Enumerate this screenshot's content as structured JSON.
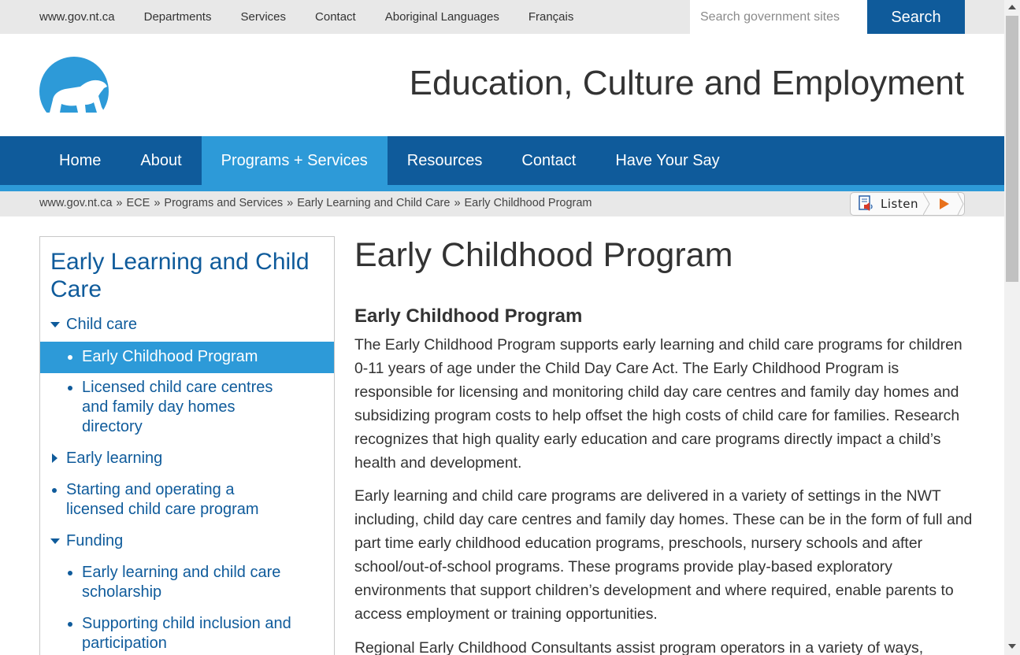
{
  "topbar": {
    "links": [
      "www.gov.nt.ca",
      "Departments",
      "Services",
      "Contact",
      "Aboriginal Languages",
      "Français"
    ],
    "search_placeholder": "Search government sites",
    "search_button": "Search"
  },
  "header": {
    "title": "Education, Culture and Employment",
    "logo_icon": "polar-bear-logo"
  },
  "nav": {
    "items": [
      "Home",
      "About",
      "Programs + Services",
      "Resources",
      "Contact",
      "Have Your Say"
    ],
    "active": "Programs + Services"
  },
  "breadcrumb": {
    "items": [
      "www.gov.nt.ca",
      "ECE",
      "Programs and Services",
      "Early Learning and Child Care",
      "Early Childhood Program"
    ],
    "separator": "»"
  },
  "listen": {
    "label": "Listen",
    "icon": "speaker-doc-icon",
    "play_icon": "play-icon"
  },
  "sidebar": {
    "title": "Early Learning and Child Care",
    "items": [
      {
        "label": "Child care",
        "marker": "expanded"
      },
      {
        "label": "Early Childhood Program",
        "marker": "bullet",
        "active": true
      },
      {
        "label": "Licensed child care centres and family day homes directory",
        "marker": "bullet"
      },
      {
        "label": "Early learning",
        "marker": "collapsed"
      },
      {
        "label": "Starting and operating a licensed child care program",
        "marker": "bullet"
      },
      {
        "label": "Funding",
        "marker": "expanded"
      },
      {
        "label": "Early learning and child care scholarship",
        "marker": "bullet"
      },
      {
        "label": "Supporting child inclusion and participation",
        "marker": "bullet"
      }
    ]
  },
  "main": {
    "page_title": "Early Childhood Program",
    "section_heading": "Early Childhood Program",
    "paragraphs": [
      "The Early Childhood Program supports early learning and child care programs for children 0-11 years of age under the Child Day Care Act.  The Early Childhood Program is responsible for licensing and monitoring child day care centres and family day homes and subsidizing program costs to help offset the high costs of child care for families. Research recognizes that high quality early education and care programs directly impact a child’s health and development.",
      "Early learning and child care programs are delivered in a variety of settings in the NWT including, child day care centres and family day homes. These can be in the form of full and part time early childhood education programs, preschools, nursery schools and after school/out-of-school programs. These programs provide play-based exploratory environments that support children’s development and where required, enable parents to access employment or training opportunities.",
      "Regional Early Childhood Consultants assist program operators in a variety of ways,"
    ]
  },
  "colors": {
    "nav_blue": "#0f5b9b",
    "accent_blue": "#2d9ad8",
    "bar_grey": "#e8e8e8"
  }
}
